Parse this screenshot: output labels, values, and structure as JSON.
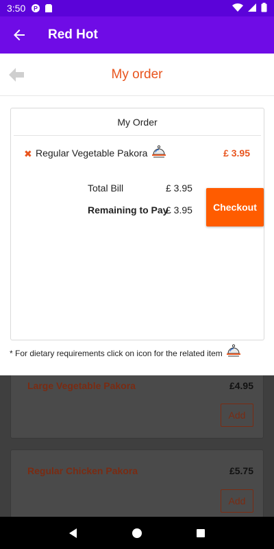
{
  "status_bar": {
    "time": "3:50"
  },
  "app_bar": {
    "title": "Red Hot"
  },
  "page": {
    "title": "My order"
  },
  "order": {
    "card_title": "My Order",
    "items": [
      {
        "name": "Regular Vegetable Pakora",
        "price": "£ 3.95"
      }
    ],
    "total_label": "Total Bill",
    "total_value": "£ 3.95",
    "remaining_label": "Remaining to Pay",
    "remaining_value": "£ 3.95",
    "checkout_label": "Checkout"
  },
  "note": {
    "text": "* For dietary requirements click on icon for the related item"
  },
  "menu_behind": [
    {
      "name": "Large Vegetable Pakora",
      "price": "£4.95",
      "add_label": "Add"
    },
    {
      "name": "Regular Chicken Pakora",
      "price": "£5.75",
      "add_label": "Add"
    }
  ],
  "colors": {
    "status_bar": "#5b03d9",
    "app_bar": "#6f0ce6",
    "accent": "#e8541d",
    "checkout": "#ff5c00"
  },
  "icons": {
    "status": [
      "notification-p-icon",
      "sim-card-icon",
      "wifi-icon",
      "signal-icon",
      "battery-icon"
    ],
    "dietary": "food-cloche-icon"
  }
}
